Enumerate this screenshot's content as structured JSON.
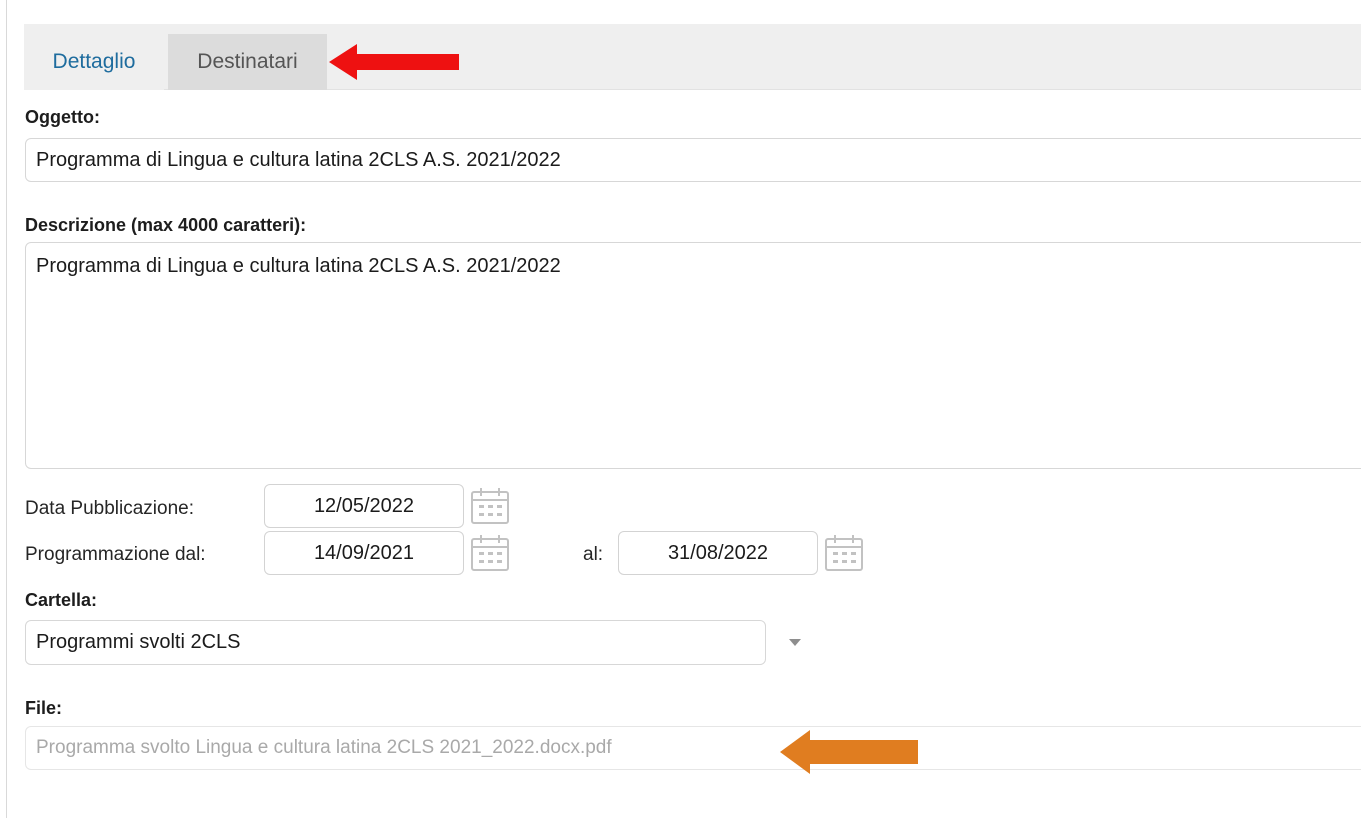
{
  "tabs": [
    {
      "label": "Dettaglio",
      "active": true
    },
    {
      "label": "Destinatari",
      "active": false
    }
  ],
  "oggetto": {
    "label": "Oggetto:",
    "value": "Programma di Lingua e cultura latina 2CLS  A.S. 2021/2022"
  },
  "descrizione": {
    "label": "Descrizione (max 4000 caratteri):",
    "value": "Programma di Lingua e cultura latina 2CLS  A.S. 2021/2022"
  },
  "pubblicazione": {
    "label": "Data Pubblicazione:",
    "value": "12/05/2022"
  },
  "programmazione": {
    "from_label": "Programmazione dal:",
    "from_value": "14/09/2021",
    "to_label": "al:",
    "to_value": "31/08/2022"
  },
  "cartella": {
    "label": "Cartella:",
    "selected": "Programmi svolti 2CLS"
  },
  "file": {
    "label": "File:",
    "value": "Programma svolto Lingua e cultura latina 2CLS 2021_2022.docx.pdf"
  },
  "icons": {
    "calendar": "calendar-icon",
    "dropdown": "chevron-down-icon",
    "annotation_red": "arrow-left-icon",
    "annotation_orange": "arrow-left-icon"
  },
  "colors": {
    "active_tab_text": "#1e6c9e",
    "annotation_red": "#ee1111",
    "annotation_orange": "#e07d20"
  }
}
